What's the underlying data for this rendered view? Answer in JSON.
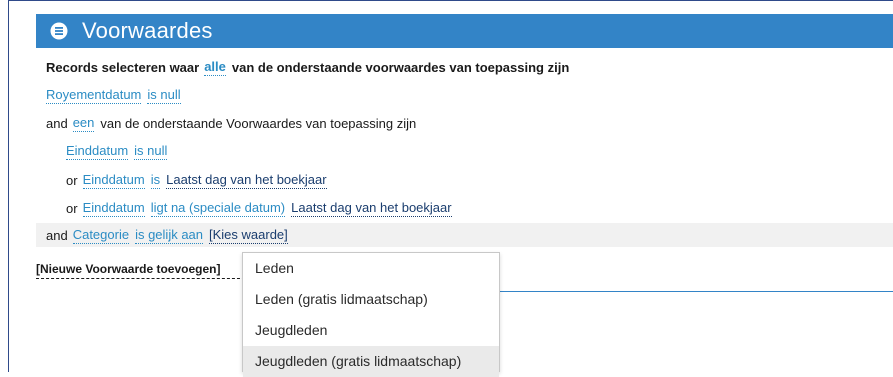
{
  "header": {
    "title": "Voorwaardes",
    "icon": "list-icon",
    "color": "#3384c7"
  },
  "conditions": {
    "intro": {
      "prefix": "Records selecteren waar",
      "quantifier": "alle",
      "suffix": "van de onderstaande voorwaardes van toepassing zijn"
    },
    "row1": {
      "field": "Royementdatum",
      "operator": "is null"
    },
    "row2": {
      "connector": "and",
      "quantifier": "een",
      "suffix": "van de onderstaande Voorwaardes van toepassing zijn"
    },
    "row3": {
      "field": "Einddatum",
      "operator": "is null"
    },
    "row4": {
      "connector": "or",
      "field": "Einddatum",
      "operator": "is",
      "value": "Laatst dag van het boekjaar"
    },
    "row5": {
      "connector": "or",
      "field": "Einddatum",
      "operator": "ligt na (speciale datum)",
      "value": "Laatst dag van het boekjaar"
    },
    "row6": {
      "connector": "and",
      "field": "Categorie",
      "operator": "is gelijk aan",
      "value": "[Kies waarde]"
    }
  },
  "add_condition": "[Nieuwe Voorwaarde toevoegen]",
  "dropdown": {
    "options": [
      "Leden",
      "Leden (gratis lidmaatschap)",
      "Jeugdleden",
      "Jeugdleden (gratis lidmaatschap)"
    ],
    "hovered_index": 3
  }
}
